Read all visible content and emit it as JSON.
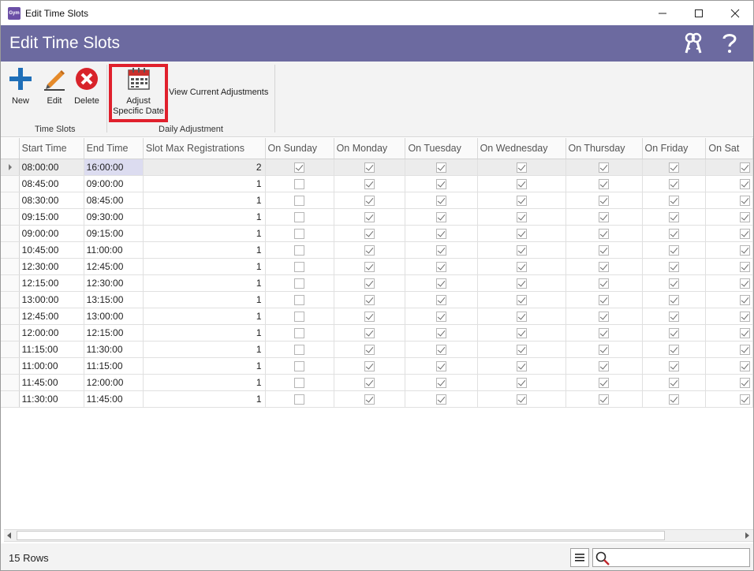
{
  "window": {
    "title": "Edit Time Slots",
    "app_icon_text": "Gym"
  },
  "header": {
    "title": "Edit Time Slots"
  },
  "ribbon": {
    "new_label": "New",
    "edit_label": "Edit",
    "delete_label": "Delete",
    "adjust_label_line1": "Adjust",
    "adjust_label_line2": "Specific Date",
    "view_adjustments_label": "View Current Adjustments",
    "group_time_slots": "Time Slots",
    "group_daily_adjustment": "Daily Adjustment"
  },
  "grid": {
    "columns": [
      "Start Time",
      "End Time",
      "Slot Max Registrations",
      "On Sunday",
      "On Monday",
      "On Tuesday",
      "On Wednesday",
      "On Thursday",
      "On Friday",
      "On Sat"
    ],
    "rows": [
      {
        "start": "08:00:00",
        "end": "16:00:00",
        "max": "2",
        "sun": true
      },
      {
        "start": "08:45:00",
        "end": "09:00:00",
        "max": "1",
        "sun": false
      },
      {
        "start": "08:30:00",
        "end": "08:45:00",
        "max": "1",
        "sun": false
      },
      {
        "start": "09:15:00",
        "end": "09:30:00",
        "max": "1",
        "sun": false
      },
      {
        "start": "09:00:00",
        "end": "09:15:00",
        "max": "1",
        "sun": false
      },
      {
        "start": "10:45:00",
        "end": "11:00:00",
        "max": "1",
        "sun": false
      },
      {
        "start": "12:30:00",
        "end": "12:45:00",
        "max": "1",
        "sun": false
      },
      {
        "start": "12:15:00",
        "end": "12:30:00",
        "max": "1",
        "sun": false
      },
      {
        "start": "13:00:00",
        "end": "13:15:00",
        "max": "1",
        "sun": false
      },
      {
        "start": "12:45:00",
        "end": "13:00:00",
        "max": "1",
        "sun": false
      },
      {
        "start": "12:00:00",
        "end": "12:15:00",
        "max": "1",
        "sun": false
      },
      {
        "start": "11:15:00",
        "end": "11:30:00",
        "max": "1",
        "sun": false
      },
      {
        "start": "11:00:00",
        "end": "11:15:00",
        "max": "1",
        "sun": false
      },
      {
        "start": "11:45:00",
        "end": "12:00:00",
        "max": "1",
        "sun": false
      },
      {
        "start": "11:30:00",
        "end": "11:45:00",
        "max": "1",
        "sun": false
      }
    ]
  },
  "status": {
    "row_count": "15 Rows",
    "search_placeholder": ""
  },
  "colors": {
    "header_bg": "#6c6aa0",
    "highlight": "#e0202c",
    "new_icon": "#1f6fb8",
    "delete_icon": "#d8232a"
  }
}
